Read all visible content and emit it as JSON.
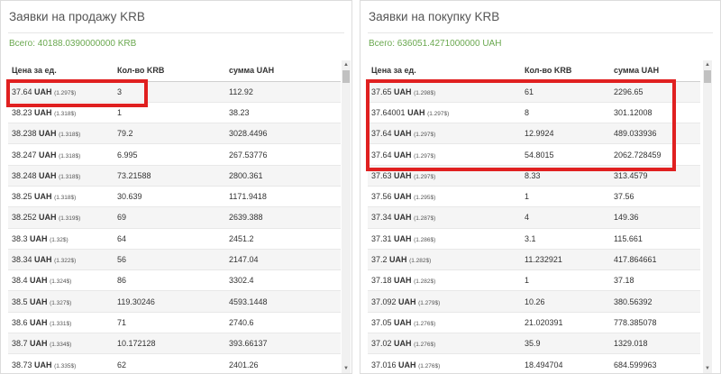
{
  "sell": {
    "title": "Заявки на продажу KRB",
    "total": "Всего: 40188.0390000000 KRB",
    "headers": [
      "Цена за ед.",
      "Кол-во KRB",
      "сумма UAH"
    ],
    "rows": [
      {
        "price": "37.64",
        "cur": "UAH",
        "usd": "(1.297$)",
        "qty": "3",
        "sum": "112.92"
      },
      {
        "price": "38.23",
        "cur": "UAH",
        "usd": "(1.318$)",
        "qty": "1",
        "sum": "38.23"
      },
      {
        "price": "38.238",
        "cur": "UAH",
        "usd": "(1.318$)",
        "qty": "79.2",
        "sum": "3028.4496"
      },
      {
        "price": "38.247",
        "cur": "UAH",
        "usd": "(1.318$)",
        "qty": "6.995",
        "sum": "267.53776"
      },
      {
        "price": "38.248",
        "cur": "UAH",
        "usd": "(1.318$)",
        "qty": "73.21588",
        "sum": "2800.361"
      },
      {
        "price": "38.25",
        "cur": "UAH",
        "usd": "(1.318$)",
        "qty": "30.639",
        "sum": "1171.9418"
      },
      {
        "price": "38.252",
        "cur": "UAH",
        "usd": "(1.319$)",
        "qty": "69",
        "sum": "2639.388"
      },
      {
        "price": "38.3",
        "cur": "UAH",
        "usd": "(1.32$)",
        "qty": "64",
        "sum": "2451.2"
      },
      {
        "price": "38.34",
        "cur": "UAH",
        "usd": "(1.322$)",
        "qty": "56",
        "sum": "2147.04"
      },
      {
        "price": "38.4",
        "cur": "UAH",
        "usd": "(1.324$)",
        "qty": "86",
        "sum": "3302.4"
      },
      {
        "price": "38.5",
        "cur": "UAH",
        "usd": "(1.327$)",
        "qty": "119.30246",
        "sum": "4593.1448"
      },
      {
        "price": "38.6",
        "cur": "UAH",
        "usd": "(1.331$)",
        "qty": "71",
        "sum": "2740.6"
      },
      {
        "price": "38.7",
        "cur": "UAH",
        "usd": "(1.334$)",
        "qty": "10.172128",
        "sum": "393.66137"
      },
      {
        "price": "38.73",
        "cur": "UAH",
        "usd": "(1.335$)",
        "qty": "62",
        "sum": "2401.26"
      }
    ]
  },
  "buy": {
    "title": "Заявки на покупку KRB",
    "total": "Всего: 636051.4271000000 UAH",
    "headers": [
      "Цена за ед.",
      "Кол-во KRB",
      "сумма UAH"
    ],
    "rows": [
      {
        "price": "37.65",
        "cur": "UAH",
        "usd": "(1.298$)",
        "qty": "61",
        "sum": "2296.65"
      },
      {
        "price": "37.64001",
        "cur": "UAH",
        "usd": "(1.297$)",
        "qty": "8",
        "sum": "301.12008"
      },
      {
        "price": "37.64",
        "cur": "UAH",
        "usd": "(1.297$)",
        "qty": "12.9924",
        "sum": "489.033936"
      },
      {
        "price": "37.64",
        "cur": "UAH",
        "usd": "(1.297$)",
        "qty": "54.8015",
        "sum": "2062.728459"
      },
      {
        "price": "37.63",
        "cur": "UAH",
        "usd": "(1.297$)",
        "qty": "8.33",
        "sum": "313.4579"
      },
      {
        "price": "37.56",
        "cur": "UAH",
        "usd": "(1.295$)",
        "qty": "1",
        "sum": "37.56"
      },
      {
        "price": "37.34",
        "cur": "UAH",
        "usd": "(1.287$)",
        "qty": "4",
        "sum": "149.36"
      },
      {
        "price": "37.31",
        "cur": "UAH",
        "usd": "(1.286$)",
        "qty": "3.1",
        "sum": "115.661"
      },
      {
        "price": "37.2",
        "cur": "UAH",
        "usd": "(1.282$)",
        "qty": "11.232921",
        "sum": "417.864661"
      },
      {
        "price": "37.18",
        "cur": "UAH",
        "usd": "(1.282$)",
        "qty": "1",
        "sum": "37.18"
      },
      {
        "price": "37.092",
        "cur": "UAH",
        "usd": "(1.279$)",
        "qty": "10.26",
        "sum": "380.56392"
      },
      {
        "price": "37.05",
        "cur": "UAH",
        "usd": "(1.276$)",
        "qty": "21.020391",
        "sum": "778.385078"
      },
      {
        "price": "37.02",
        "cur": "UAH",
        "usd": "(1.276$)",
        "qty": "35.9",
        "sum": "1329.018"
      },
      {
        "price": "37.016",
        "cur": "UAH",
        "usd": "(1.276$)",
        "qty": "18.494704",
        "sum": "684.599963"
      }
    ]
  },
  "scroll": {
    "up": "▲",
    "down": "▼"
  },
  "colors": {
    "highlight": "#e02020",
    "total_text": "#6aa84f",
    "zebra": "#f5f5f5"
  }
}
